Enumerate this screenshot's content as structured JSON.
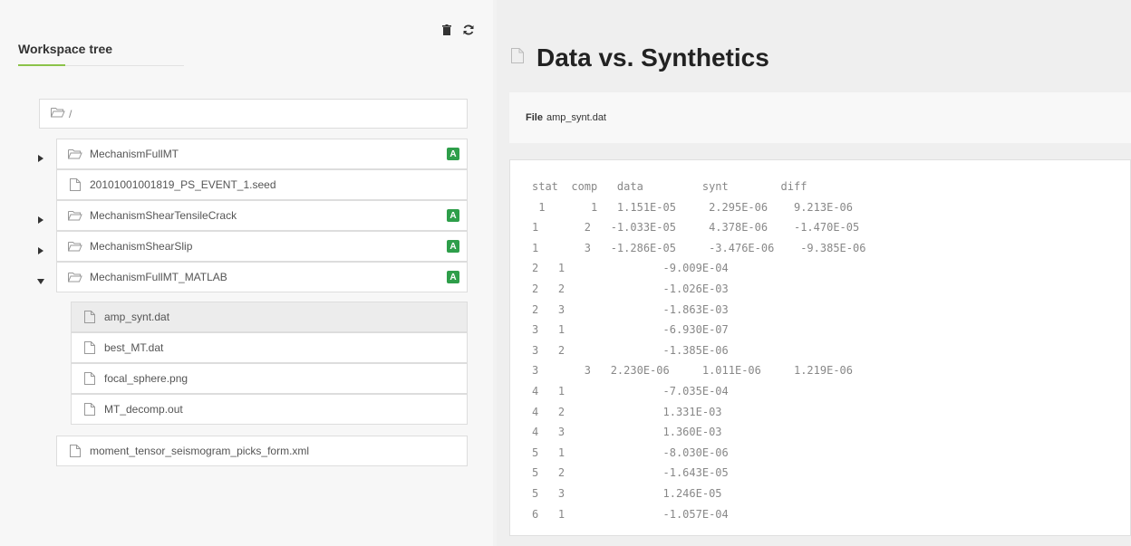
{
  "sidebar": {
    "title": "Workspace tree",
    "root_path": "/",
    "items": [
      {
        "label": "MechanismFullMT",
        "type": "folder",
        "badge": "A"
      },
      {
        "label": "20101001001819_PS_EVENT_1.seed",
        "type": "file",
        "badge": ""
      },
      {
        "label": "MechanismShearTensileCrack",
        "type": "folder",
        "badge": "A"
      },
      {
        "label": "MechanismShearSlip",
        "type": "folder",
        "badge": "A"
      },
      {
        "label": "MechanismFullMT_MATLAB",
        "type": "folder",
        "badge": "A"
      }
    ],
    "children": [
      {
        "label": "amp_synt.dat"
      },
      {
        "label": "best_MT.dat"
      },
      {
        "label": "focal_sphere.png"
      },
      {
        "label": "MT_decomp.out"
      }
    ],
    "last_item": {
      "label": "moment_tensor_seismogram_picks_form.xml"
    }
  },
  "main": {
    "title": "Data vs. Synthetics",
    "file_label": "File",
    "file_name": "amp_synt.dat",
    "lines": [
      "stat  comp   data         synt        diff",
      " 1       1   1.151E-05     2.295E-06    9.213E-06",
      "1       2   -1.033E-05     4.378E-06    -1.470E-05",
      "1       3   -1.286E-05     -3.476E-06    -9.385E-06",
      "2   1               -9.009E-04",
      "2   2               -1.026E-03",
      "2   3               -1.863E-03",
      "3   1               -6.930E-07",
      "3   2               -1.385E-06",
      "3       3   2.230E-06     1.011E-06     1.219E-06",
      "4   1               -7.035E-04",
      "4   2               1.331E-03",
      "4   3               1.360E-03",
      "5   1               -8.030E-06",
      "5   2               -1.643E-05",
      "5   3               1.246E-05",
      "6   1               -1.057E-04"
    ]
  },
  "icons": {
    "trash": "trash-icon",
    "refresh": "refresh-icon",
    "folder": "folder-icon",
    "file": "file-icon"
  },
  "colors": {
    "accent": "#8bc34a",
    "badge": "#2e9e4a"
  }
}
